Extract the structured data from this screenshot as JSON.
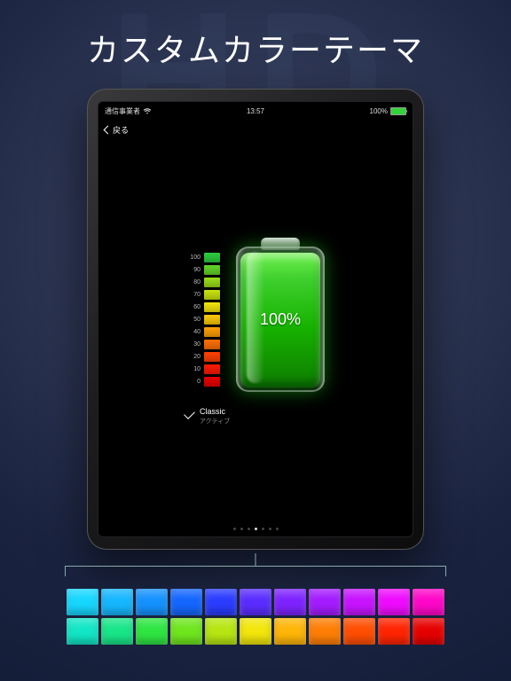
{
  "watermark": "HD",
  "headline": "カスタムカラーテーマ",
  "statusbar": {
    "carrier": "通信事業者",
    "time": "13:57",
    "battery_pct": "100%"
  },
  "navbar": {
    "back_label": "戻る"
  },
  "battery": {
    "percent_label": "100%",
    "fill_percent": 100
  },
  "scale": {
    "ticks": [
      {
        "label": "100",
        "color": "#2ecc40"
      },
      {
        "label": "90",
        "color": "#63d42a"
      },
      {
        "label": "80",
        "color": "#9bdc1a"
      },
      {
        "label": "70",
        "color": "#c9e312"
      },
      {
        "label": "60",
        "color": "#f4e60e"
      },
      {
        "label": "50",
        "color": "#ffca0a"
      },
      {
        "label": "40",
        "color": "#ff9e08"
      },
      {
        "label": "30",
        "color": "#ff7006"
      },
      {
        "label": "20",
        "color": "#ff4004"
      },
      {
        "label": "10",
        "color": "#ff1a02"
      },
      {
        "label": "0",
        "color": "#e60000"
      }
    ]
  },
  "theme": {
    "name": "Classic",
    "status": "アクティブ"
  },
  "page_dots": {
    "count": 7,
    "active_index": 3
  },
  "palette": {
    "row1": [
      "#17d7ff",
      "#16b7ff",
      "#1592ff",
      "#1466ff",
      "#2a3cff",
      "#5a2cff",
      "#7e23ff",
      "#a41bff",
      "#c813ff",
      "#ef0bff",
      "#ff07c9"
    ],
    "row2": [
      "#12e6c6",
      "#18e689",
      "#2ee642",
      "#6fe61e",
      "#b6e612",
      "#f2e60c",
      "#ffb608",
      "#ff7e05",
      "#ff4e03",
      "#ff2402",
      "#e60000"
    ]
  }
}
